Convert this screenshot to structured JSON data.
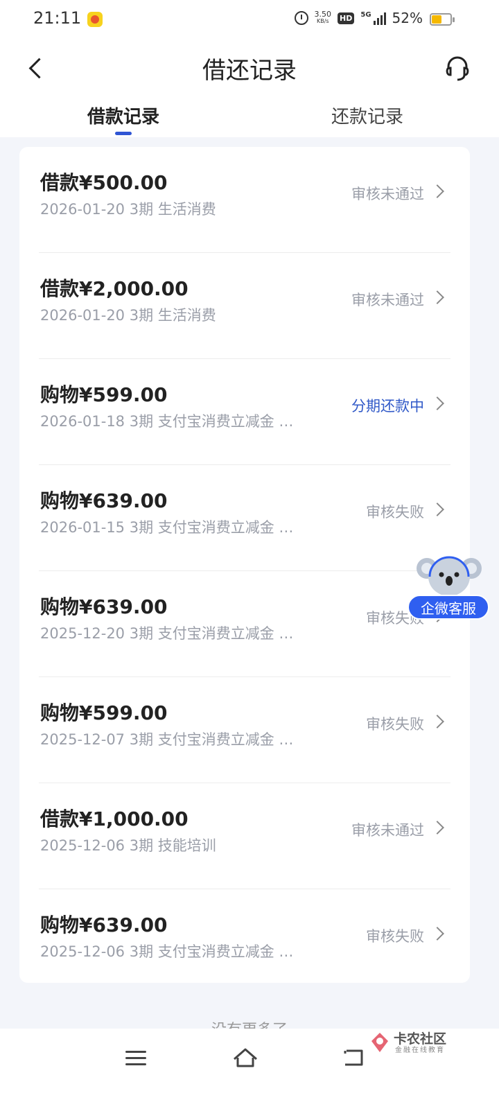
{
  "status_bar": {
    "time": "21:11",
    "net_speed": "3.50",
    "net_unit": "KB/s",
    "hd": "HD",
    "network": "5G",
    "battery": "52%",
    "battery_level": 0.52
  },
  "header": {
    "title": "借还记录",
    "back_icon": "chevron-left-icon",
    "service_icon": "headset-icon"
  },
  "tabs": [
    {
      "label": "借款记录",
      "active": true
    },
    {
      "label": "还款记录",
      "active": false
    }
  ],
  "colors": {
    "accent": "#2f55d4",
    "status_active": "#3059c8",
    "status_muted": "#9a9ea8"
  },
  "records": [
    {
      "amount": "借款¥500.00",
      "meta": "2026-01-20 3期  生活消费",
      "status": "审核未通过"
    },
    {
      "amount": "借款¥2,000.00",
      "meta": "2026-01-20 3期  生活消费",
      "status": "审核未通过"
    },
    {
      "amount": "购物¥599.00",
      "meta": "2026-01-18 3期  支付宝消费立减金 …",
      "status": "分期还款中"
    },
    {
      "amount": "购物¥639.00",
      "meta": "2026-01-15 3期  支付宝消费立减金 …",
      "status": "审核失败"
    },
    {
      "amount": "购物¥639.00",
      "meta": "2025-12-20 3期  支付宝消费立减金 …",
      "status": "审核失败"
    },
    {
      "amount": "购物¥599.00",
      "meta": "2025-12-07 3期  支付宝消费立减金 …",
      "status": "审核失败"
    },
    {
      "amount": "借款¥1,000.00",
      "meta": "2025-12-06 3期  技能培训",
      "status": "审核未通过"
    },
    {
      "amount": "购物¥639.00",
      "meta": "2025-12-06 3期  支付宝消费立减金 …",
      "status": "审核失败"
    }
  ],
  "floating_service": {
    "label": "企微客服",
    "icon": "koala-icon"
  },
  "footer_text": "没有更多了",
  "watermark": {
    "title": "卡农社区",
    "subtitle": "金融在线教育"
  },
  "nav_bar": {
    "icons": [
      "menu-icon",
      "home-icon",
      "back-icon"
    ]
  }
}
